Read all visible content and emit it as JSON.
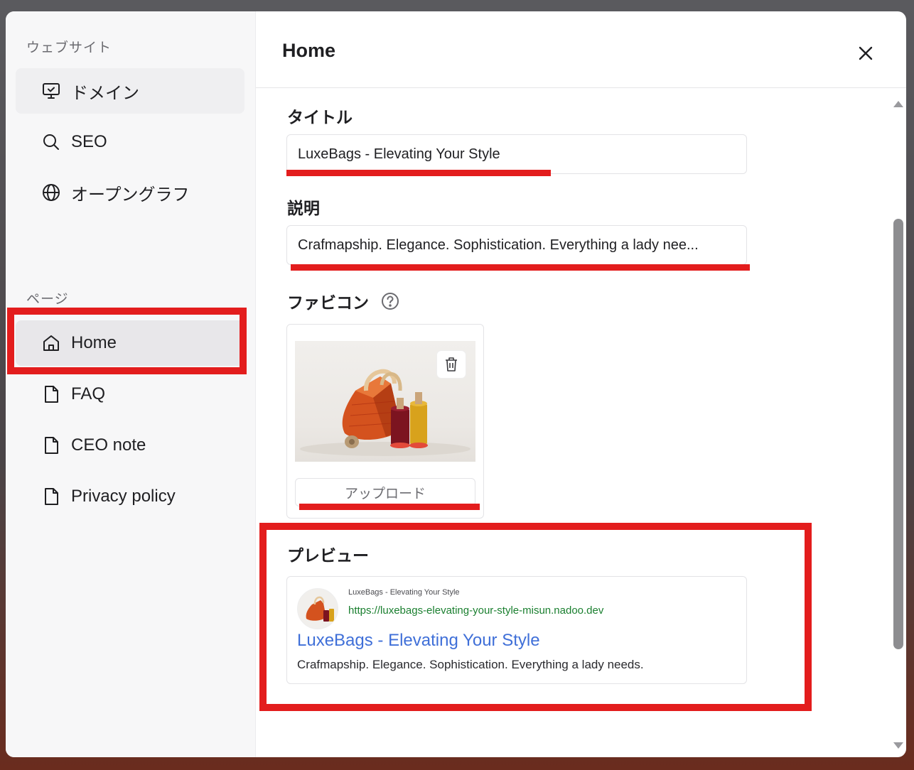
{
  "sidebar": {
    "website_label": "ウェブサイト",
    "website_items": [
      {
        "label": "ドメイン",
        "icon": "monitor-icon"
      },
      {
        "label": "SEO",
        "icon": "search-icon"
      },
      {
        "label": "オープングラフ",
        "icon": "globe-icon"
      }
    ],
    "pages_label": "ページ",
    "page_items": [
      {
        "label": "Home",
        "icon": "home-icon"
      },
      {
        "label": "FAQ",
        "icon": "file-icon"
      },
      {
        "label": "CEO note",
        "icon": "file-icon"
      },
      {
        "label": "Privacy policy",
        "icon": "file-icon"
      }
    ]
  },
  "header": {
    "title": "Home"
  },
  "form": {
    "title_label": "タイトル",
    "title_value": "LuxeBags - Elevating Your Style",
    "description_label": "説明",
    "description_value": "Crafmapship. Elegance. Sophistication. Everything a lady nee...",
    "favicon_label": "ファビコン",
    "upload_label": "アップロード"
  },
  "preview": {
    "label": "プレビュー",
    "site_name": "LuxeBags - Elevating Your Style",
    "url": "https://luxebags-elevating-your-style-misun.nadoo.dev",
    "title": "LuxeBags - Elevating Your Style",
    "description": "Crafmapship. Elegance. Sophistication. Everything a lady needs."
  },
  "colors": {
    "highlight_red": "#e31d1d",
    "preview_link": "#3f6fd8",
    "preview_url": "#1a7f2f"
  }
}
